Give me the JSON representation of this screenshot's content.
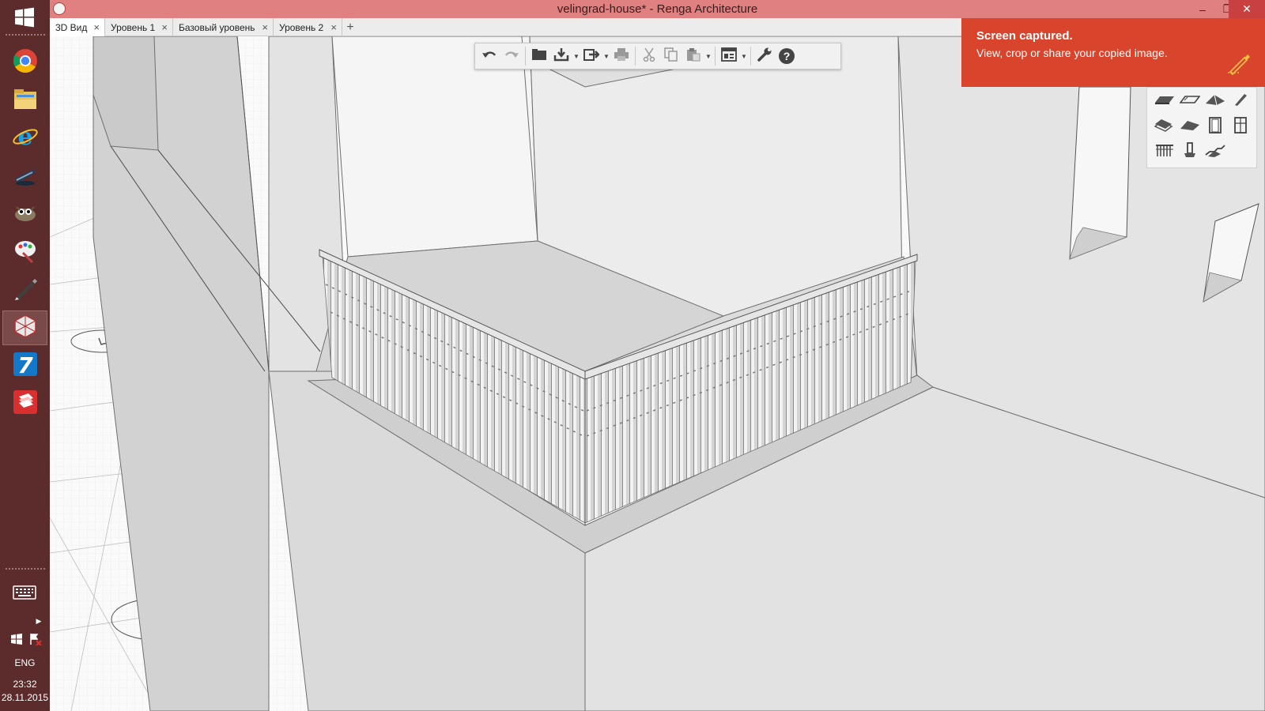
{
  "window": {
    "title": "velingrad-house* - Renga Architecture",
    "minimize": "–",
    "restore": "❐",
    "close": "✕"
  },
  "tabs": [
    {
      "label": "3D Вид",
      "active": true
    },
    {
      "label": "Уровень 1",
      "active": false
    },
    {
      "label": "Базовый уровень",
      "active": false
    },
    {
      "label": "Уровень 2",
      "active": false
    }
  ],
  "tab_close_glyph": "×",
  "tab_add_glyph": "+",
  "toolbar": {
    "icons": [
      "undo-icon",
      "redo-icon",
      "open-folder-icon",
      "save-icon",
      "export-icon",
      "print-icon",
      "cut-icon",
      "copy-icon",
      "paste-icon",
      "view-icon",
      "settings-wrench-icon",
      "help-icon"
    ],
    "help_glyph": "?"
  },
  "palette": {
    "icons": [
      "wall-icon",
      "slab-icon",
      "roof-icon",
      "beam-icon",
      "floor-icon",
      "ramp-icon",
      "door-icon",
      "window-icon",
      "railing-icon",
      "column-icon",
      "stair-icon"
    ]
  },
  "toast": {
    "title": "Screen captured.",
    "body": "View, crop or share your copied image.",
    "accent": "#d8442c"
  },
  "taskbar": {
    "apps": [
      "chrome-icon",
      "file-explorer-icon",
      "internet-explorer-icon",
      "app-icon",
      "gimp-icon",
      "paint-icon",
      "pen-icon",
      "renga-icon",
      "app-7-icon",
      "sketchup-icon"
    ],
    "language": "ENG",
    "time": "23:32",
    "date": "28.11.2015"
  },
  "colors": {
    "titlebar": "#e08080",
    "taskbar": "#5c2b2b"
  }
}
